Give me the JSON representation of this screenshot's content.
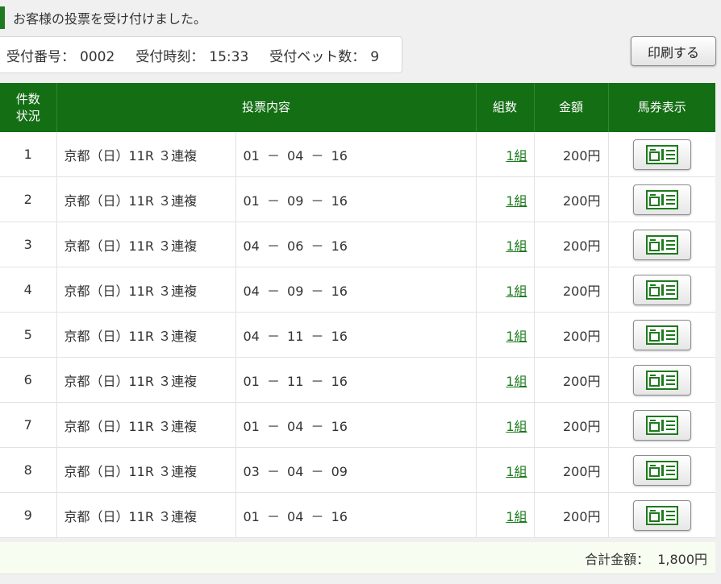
{
  "message": "お客様の投票を受け付けました。",
  "receipt": {
    "number_label": "受付番号：",
    "number_value": "0002",
    "time_label": "受付時刻：",
    "time_value": "15:33",
    "bet_count_label": "受付ベット数：",
    "bet_count_value": "9"
  },
  "print_button": "印刷する",
  "table": {
    "headers": {
      "no_line1": "件数",
      "no_line2": "状況",
      "content": "投票内容",
      "kumi": "組数",
      "amount": "金額",
      "ticket": "馬券表示"
    },
    "rows": [
      {
        "no": "1",
        "race": "京都（日）11R ３連複",
        "combo": "01 － 04 － 16",
        "kumi": "1組",
        "amount": "200円"
      },
      {
        "no": "2",
        "race": "京都（日）11R ３連複",
        "combo": "01 － 09 － 16",
        "kumi": "1組",
        "amount": "200円"
      },
      {
        "no": "3",
        "race": "京都（日）11R ３連複",
        "combo": "04 － 06 － 16",
        "kumi": "1組",
        "amount": "200円"
      },
      {
        "no": "4",
        "race": "京都（日）11R ３連複",
        "combo": "04 － 09 － 16",
        "kumi": "1組",
        "amount": "200円"
      },
      {
        "no": "5",
        "race": "京都（日）11R ３連複",
        "combo": "04 － 11 － 16",
        "kumi": "1組",
        "amount": "200円"
      },
      {
        "no": "6",
        "race": "京都（日）11R ３連複",
        "combo": "01 － 11 － 16",
        "kumi": "1組",
        "amount": "200円"
      },
      {
        "no": "7",
        "race": "京都（日）11R ３連複",
        "combo": "01 － 04 － 16",
        "kumi": "1組",
        "amount": "200円"
      },
      {
        "no": "8",
        "race": "京都（日）11R ３連複",
        "combo": "03 － 04 － 09",
        "kumi": "1組",
        "amount": "200円"
      },
      {
        "no": "9",
        "race": "京都（日）11R ３連複",
        "combo": "01 － 04 － 16",
        "kumi": "1組",
        "amount": "200円"
      }
    ]
  },
  "total": {
    "label": "合計金額：",
    "value": "1,800円"
  },
  "colors": {
    "header_green": "#146e14",
    "accent_green": "#1e7a1e",
    "total_bg": "#f7fdf0"
  },
  "icons": {
    "ticket": "ticket-icon"
  }
}
